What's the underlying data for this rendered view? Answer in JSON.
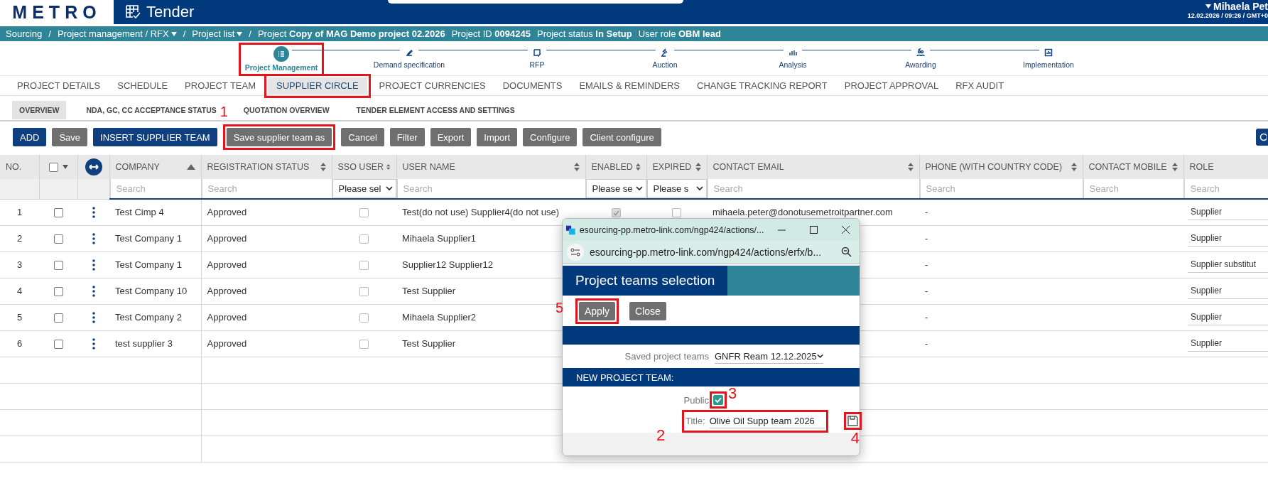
{
  "header": {
    "logo": "METRO",
    "app_title": "Tender",
    "user": "Mihaela Pet",
    "datetime": "12.02.2026 / 09:26 / GMT+0"
  },
  "breadcrumb": [
    {
      "kind": "link",
      "label": "Sourcing"
    },
    {
      "kind": "separator",
      "label": "/"
    },
    {
      "kind": "link",
      "label": "Project management / RFX",
      "dropdown": true
    },
    {
      "kind": "separator",
      "label": "/"
    },
    {
      "kind": "link",
      "label": "Project list",
      "dropdown": true
    },
    {
      "kind": "separator",
      "label": "/"
    }
  ],
  "project_info": [
    "Project **Copy of MAG Demo project 02.2026**",
    "Project ID **0094245**",
    "Project status **In Setup**",
    "User role **OBM lead**"
  ],
  "steps": [
    {
      "label": "Project Management",
      "selected": true,
      "highlighted": true,
      "kind": "list"
    },
    {
      "label": "Demand specification",
      "selected": false,
      "kind": "pen"
    },
    {
      "label": "RFP",
      "selected": false,
      "kind": "check"
    },
    {
      "label": "Auction",
      "selected": false,
      "kind": "gavel"
    },
    {
      "label": "Analysis",
      "selected": false,
      "kind": "bars"
    },
    {
      "label": "Awarding",
      "selected": false,
      "kind": "people"
    },
    {
      "label": "Implementation",
      "selected": false,
      "kind": "chart"
    }
  ],
  "tabs": [
    {
      "label": "PROJECT DETAILS",
      "selected": false
    },
    {
      "label": "SCHEDULE",
      "selected": false
    },
    {
      "label": "PROJECT TEAM",
      "selected": false
    },
    {
      "label": "SUPPLIER CIRCLE",
      "selected": true,
      "highlighted": true
    },
    {
      "label": "PROJECT CURRENCIES",
      "selected": false
    },
    {
      "label": "DOCUMENTS",
      "selected": false
    },
    {
      "label": "EMAILS & REMINDERS",
      "selected": false
    },
    {
      "label": "CHANGE TRACKING REPORT",
      "selected": false
    },
    {
      "label": "PROJECT APPROVAL",
      "selected": false
    },
    {
      "label": "RFX AUDIT",
      "selected": false
    }
  ],
  "subtabs": [
    {
      "label": "OVERVIEW",
      "selected": true
    },
    {
      "label": "NDA, GC, CC ACCEPTANCE STATUS",
      "selected": false
    },
    {
      "label": "QUOTATION OVERVIEW",
      "selected": false
    },
    {
      "label": "TENDER ELEMENT ACCESS AND SETTINGS",
      "selected": false
    }
  ],
  "toolbar": [
    {
      "label": "ADD",
      "kind": "primary"
    },
    {
      "label": "Save",
      "kind": "secondary"
    },
    {
      "label": "INSERT SUPPLIER TEAM",
      "kind": "primary"
    },
    {
      "label": "Save supplier team as",
      "kind": "secondary",
      "highlighted": true,
      "callout": "1"
    },
    {
      "label": "Cancel",
      "kind": "secondary"
    },
    {
      "label": "Filter",
      "kind": "secondary"
    },
    {
      "label": "Export",
      "kind": "secondary"
    },
    {
      "label": "Import",
      "kind": "secondary"
    },
    {
      "label": "Configure",
      "kind": "secondary"
    },
    {
      "label": "Client configure",
      "kind": "secondary"
    }
  ],
  "table": {
    "columns": [
      {
        "kind": "plain",
        "label": "NO."
      },
      {
        "kind": "select_all",
        "checked": false
      },
      {
        "kind": "expand"
      },
      {
        "kind": "sorted",
        "label": "COMPANY",
        "filter": {
          "placeholder": "Search"
        }
      },
      {
        "kind": "sortable",
        "label": "REGISTRATION STATUS",
        "filter": {
          "placeholder": "Search"
        }
      },
      {
        "kind": "sortable",
        "label": "SSO USER",
        "filter": {
          "value": "Please sel"
        }
      },
      {
        "kind": "sortable",
        "label": "USER NAME",
        "filter": {
          "placeholder": "Search"
        }
      },
      {
        "kind": "sortable",
        "label": "ENABLED",
        "filter": {
          "value": "Please se"
        }
      },
      {
        "kind": "sortable",
        "label": "EXPIRED",
        "filter": {
          "value": "Please s"
        }
      },
      {
        "kind": "sortable",
        "label": "CONTACT EMAIL",
        "filter": {
          "placeholder": "Search"
        }
      },
      {
        "kind": "sortable",
        "label": "PHONE (WITH COUNTRY CODE)",
        "filter": {
          "placeholder": "Search"
        }
      },
      {
        "kind": "sortable",
        "label": "CONTACT MOBILE",
        "filter": {
          "placeholder": "Search"
        }
      },
      {
        "kind": "plain",
        "label": "ROLE",
        "filter": {
          "placeholder": "Search"
        }
      }
    ],
    "rows": [
      {
        "no": "1",
        "checked": false,
        "company": "Test Cimp 4",
        "status": "Approved",
        "sso": false,
        "user": "Test(do not use) Supplier4(do not use)",
        "enabled": true,
        "expired": false,
        "email": "mihaela.peter@donotusemetroitpartner.com",
        "phone": "-",
        "role": "Supplier"
      },
      {
        "no": "2",
        "checked": false,
        "company": "Test Company 1",
        "status": "Approved",
        "sso": false,
        "user": "Mihaela Supplier1",
        "phone": "-",
        "role": "Supplier"
      },
      {
        "no": "3",
        "checked": false,
        "company": "Test Company 1",
        "status": "Approved",
        "sso": false,
        "user": "Supplier12 Supplier12",
        "phone": "-",
        "role": "Supplier substitut"
      },
      {
        "no": "4",
        "checked": false,
        "company": "Test Company 10",
        "status": "Approved",
        "sso": false,
        "user": "Test Supplier",
        "phone": "-",
        "role": "Supplier"
      },
      {
        "no": "5",
        "checked": false,
        "company": "Test Company 2",
        "status": "Approved",
        "sso": false,
        "user": "Mihaela Supplier2",
        "phone": "-",
        "role": "Supplier"
      },
      {
        "no": "6",
        "checked": false,
        "company": "test supplier 3",
        "status": "Approved",
        "sso": false,
        "user": "Test Supplier",
        "phone": "-",
        "role": "Supplier"
      }
    ]
  },
  "popup": {
    "window_title": "esourcing-pp.metro-link.com/ngp424/actions/...",
    "address": "esourcing-pp.metro-link.com/ngp424/actions/erfx/b...",
    "title": "Project teams selection",
    "buttons": [
      {
        "label": "Apply",
        "highlighted": true,
        "callout": "5"
      },
      {
        "label": "Close",
        "highlighted": false
      }
    ],
    "saved_label": "Saved project teams",
    "saved_value": "GNFR Ream 12.12.2025",
    "section": "NEW PROJECT TEAM:",
    "public": {
      "label": "Public",
      "checked": true,
      "highlighted": true,
      "callout": "3"
    },
    "title_field": {
      "label": "Title:",
      "value": "Olive Oil Supp team 2026",
      "highlighted": true,
      "callout": "2"
    },
    "save_icon": {
      "highlighted": true,
      "callout": "4"
    }
  }
}
